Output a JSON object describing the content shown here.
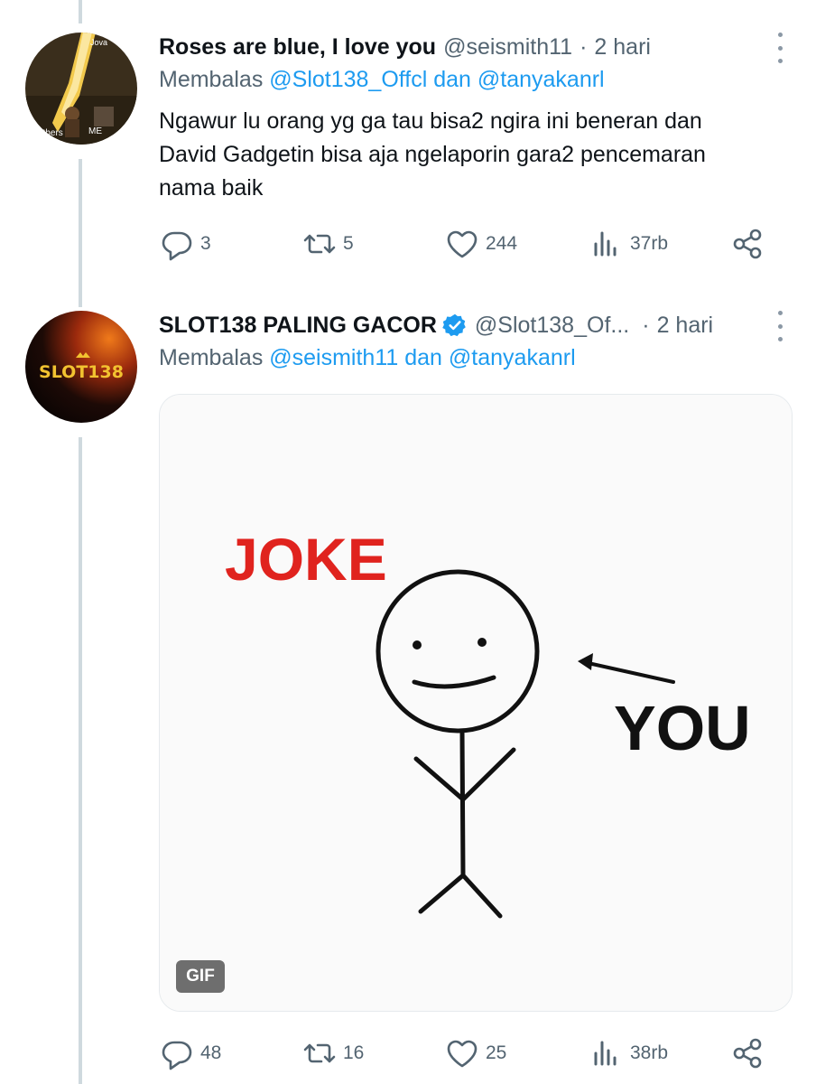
{
  "tweets": [
    {
      "name": "Roses are blue, I love you",
      "handle": "@seismith11",
      "separator": "·",
      "time": "2 hari",
      "reply_prefix": "Membalas ",
      "reply_mention_1": "@Slot138_Offcl",
      "reply_and": " dan ",
      "reply_mention_2": "@tanyakanrl",
      "text_lines": [
        "Ngawur lu orang yg ga tau bisa2 ngira ini beneran dan",
        "David Gadgetin bisa aja ngelaporin gara2 pencemaran",
        "nama baik"
      ],
      "avatar_labels": {
        "top": "Jova",
        "left": "others",
        "right": "ME"
      },
      "actions": {
        "replies": "3",
        "retweets": "5",
        "likes": "244",
        "views": "37rb"
      }
    },
    {
      "name": "SLOT138 PALING GACOR",
      "verified": true,
      "handle": "@Slot138_Of...",
      "separator": "·",
      "time": "2 hari",
      "reply_prefix": "Membalas ",
      "reply_mention_1": "@seismith11",
      "reply_and": " dan ",
      "reply_mention_2": "@tanyakanrl",
      "avatar_text": "SLOT138",
      "media": {
        "type": "GIF",
        "badge": "GIF",
        "text_joke": "JOKE",
        "text_you": "YOU"
      },
      "actions": {
        "replies": "48",
        "retweets": "16",
        "likes": "25",
        "views": "38rb"
      }
    }
  ],
  "colors": {
    "link": "#1d9bf0",
    "secondary_text": "#536471",
    "verified_badge": "#1d9bf0",
    "joke_red": "#e0231e"
  },
  "icons": [
    "reply-icon",
    "retweet-icon",
    "like-icon",
    "views-icon",
    "share-icon",
    "more-icon",
    "verified-icon"
  ]
}
